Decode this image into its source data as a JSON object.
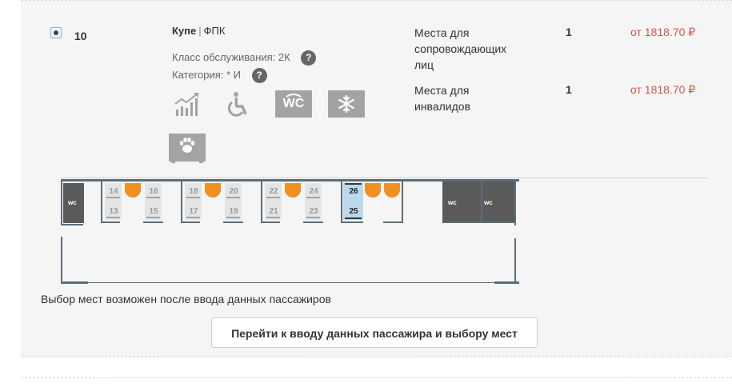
{
  "car": {
    "number": "10",
    "type": "Купе",
    "carrier": "ФПК",
    "service_class_label": "Класс обслуживания: 2К",
    "category_label": "Категория: * И",
    "help_symbol": "?"
  },
  "services": {
    "wc_label": "WC"
  },
  "tariffs": [
    {
      "name_line1": "Места для",
      "name_line2": "сопровождающих",
      "name_line3": "лиц",
      "count": "1",
      "price": "от 1818.70 ₽"
    },
    {
      "name_line1": "Места для",
      "name_line2": "инвалидов",
      "count": "1",
      "price": "от 1818.70 ₽"
    }
  ],
  "scheme": {
    "wc_label": "wc",
    "seats": [
      "14",
      "13",
      "16",
      "15",
      "18",
      "17",
      "20",
      "19",
      "22",
      "21",
      "24",
      "23",
      "26",
      "25"
    ],
    "selectable_color": "#bcd8ec",
    "occupied_color": "#e4e4e4",
    "table_color": "#f0901e",
    "wall_color": "#5b6d79",
    "wc_color": "#5a5a5a"
  },
  "note": "Выбор мест возможен после ввода данных пассажиров",
  "continue_button": "Перейти к вводу данных пассажира и выбору мест",
  "colors": {
    "price": "#d9534f",
    "icon_gray": "#a3a3a3"
  }
}
